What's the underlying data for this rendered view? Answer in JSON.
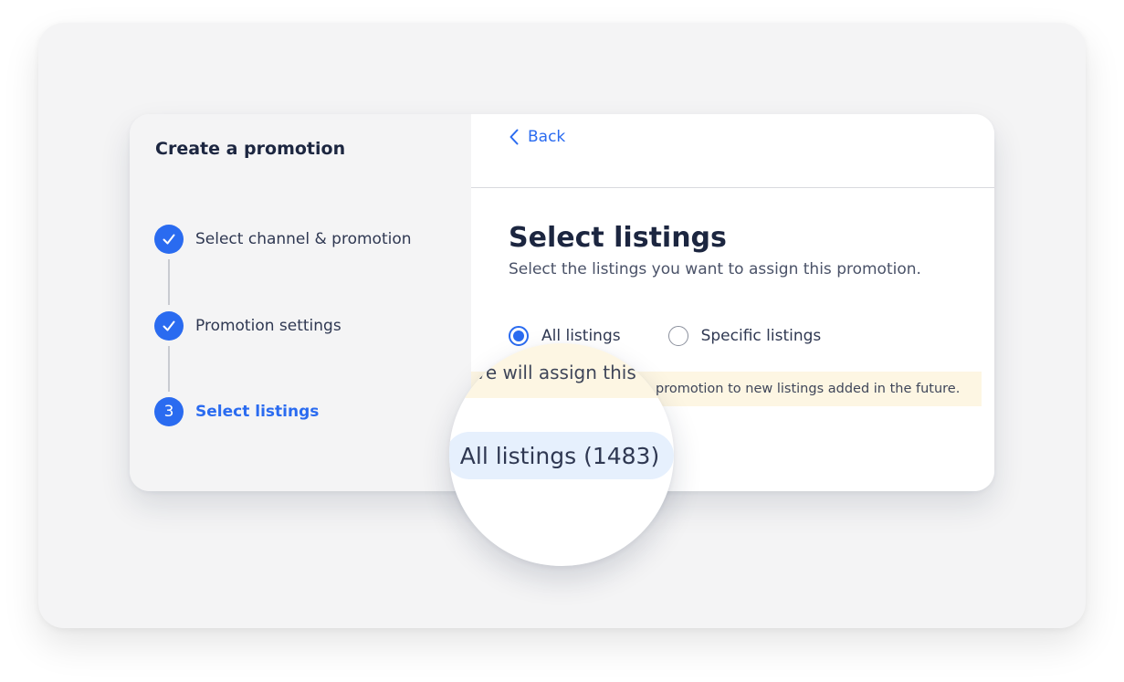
{
  "sidebar": {
    "title": "Create a promotion",
    "steps": [
      {
        "label": "Select channel & promotion",
        "status": "complete",
        "marker": "check-icon"
      },
      {
        "label": "Promotion settings",
        "status": "complete",
        "marker": "check-icon"
      },
      {
        "label": "Select listings",
        "status": "active",
        "number": "3"
      }
    ]
  },
  "main": {
    "back_label": "Back",
    "heading": "Select listings",
    "subheading": "Select the listings you want to assign this promotion.",
    "options": [
      {
        "label": "All listings",
        "selected": true
      },
      {
        "label": "Specific listings",
        "selected": false
      }
    ],
    "notice": "promotion to new listings added in the future."
  },
  "magnifier": {
    "notice_fragment": "ve will assign this",
    "listing_count_label": "All listings (1483)"
  },
  "colors": {
    "accent": "#2a6bf0",
    "sidebar_bg": "#f4f4f5",
    "notice_bg": "#fdf6e3",
    "pill_bg": "#e6f0fd"
  }
}
